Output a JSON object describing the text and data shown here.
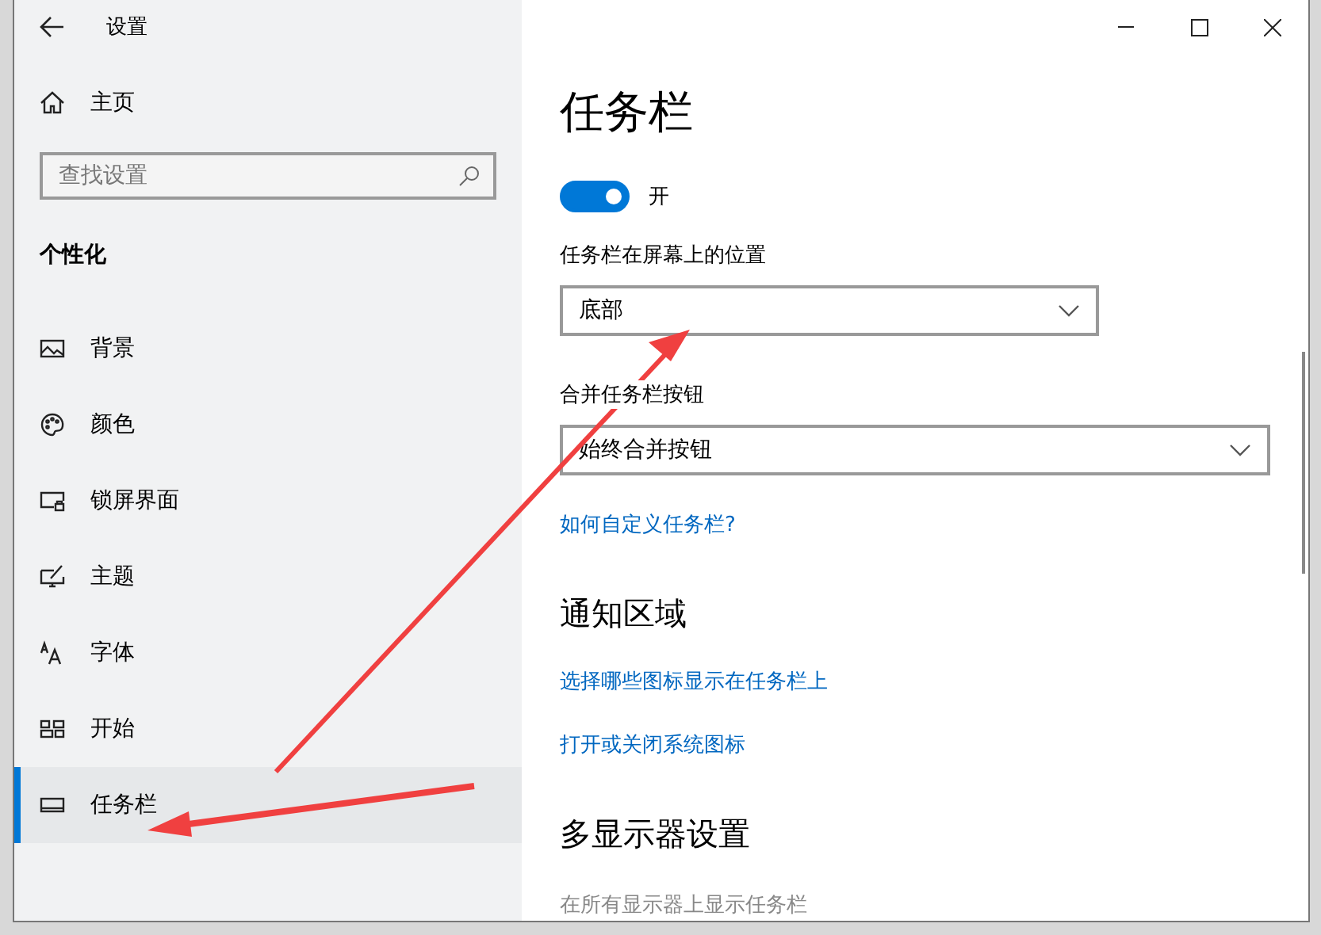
{
  "window": {
    "title": "设置"
  },
  "sidebar": {
    "home": "主页",
    "search": {
      "placeholder": "查找设置"
    },
    "section": "个性化",
    "items": [
      {
        "label": "背景",
        "selected": false
      },
      {
        "label": "颜色",
        "selected": false
      },
      {
        "label": "锁屏界面",
        "selected": false
      },
      {
        "label": "主题",
        "selected": false
      },
      {
        "label": "字体",
        "selected": false
      },
      {
        "label": "开始",
        "selected": false
      },
      {
        "label": "任务栏",
        "selected": true
      }
    ]
  },
  "page": {
    "title": "任务栏",
    "toggle": {
      "on": true,
      "label": "开"
    },
    "position": {
      "label": "任务栏在屏幕上的位置",
      "value": "底部"
    },
    "combine": {
      "label": "合并任务栏按钮",
      "value": "始终合并按钮"
    },
    "help_link": "如何自定义任务栏?",
    "notification": {
      "heading": "通知区域",
      "links": [
        "选择哪些图标显示在任务栏上",
        "打开或关闭系统图标"
      ]
    },
    "multi_display": {
      "heading": "多显示器设置",
      "setting": "在所有显示器上显示任务栏"
    }
  }
}
